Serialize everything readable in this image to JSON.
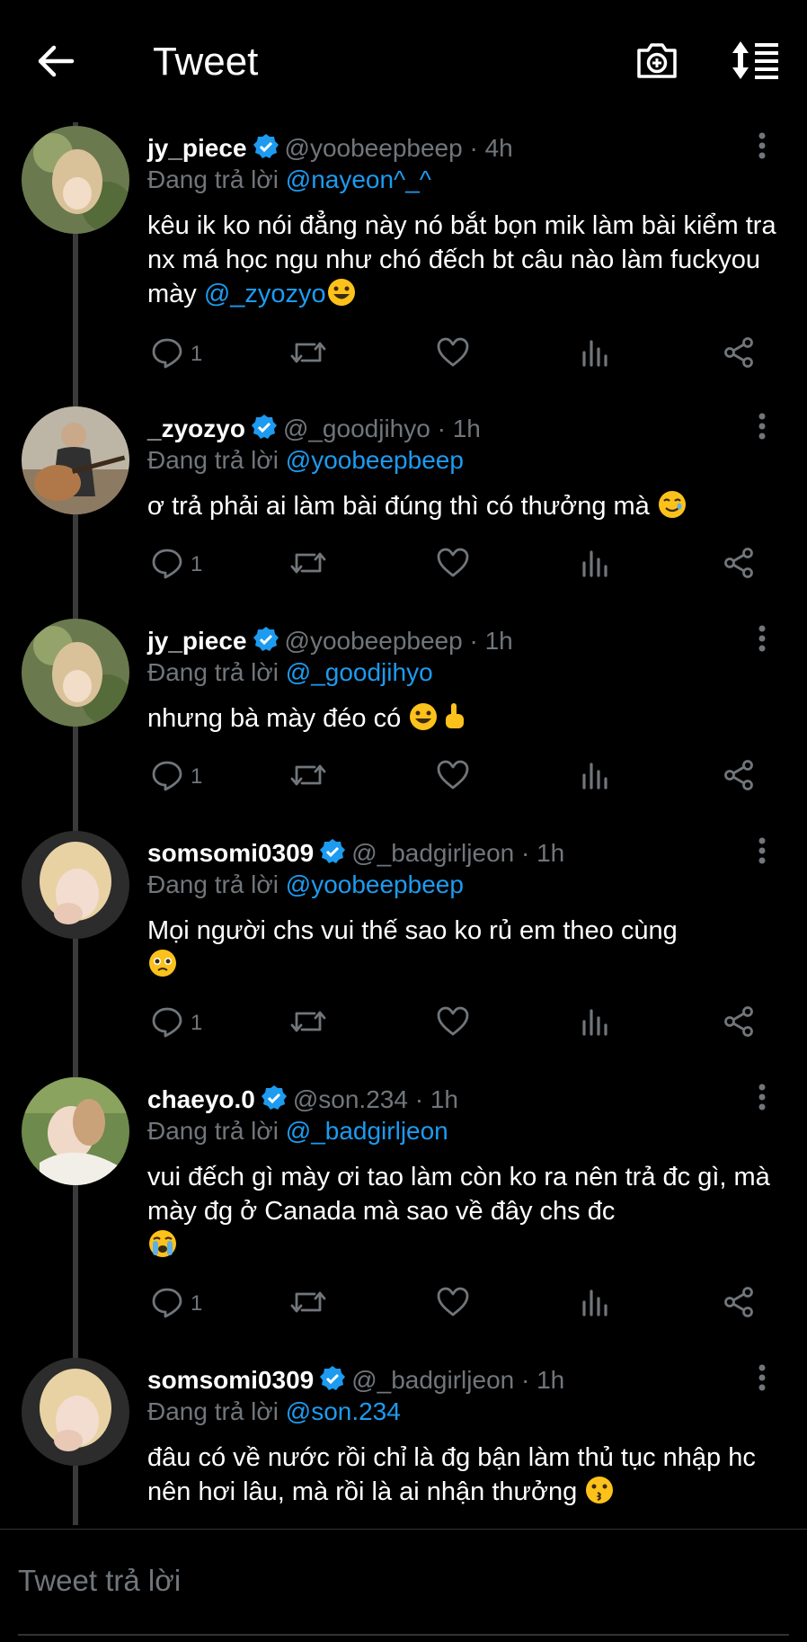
{
  "header": {
    "title": "Tweet"
  },
  "tweets": [
    {
      "name": "jy_piece",
      "handle": "@yoobeepbeep",
      "time": "· 4h",
      "reply_label": "Đang trả lời",
      "reply_to": "@nayeon^_^",
      "body": "kêu ik ko nói đẳng này nó bắt bọn mik làm bài kiểm tra nx má học ngu như chó đếch bt câu nào làm fuckyou mày ",
      "body_mention": "@_zyozyo",
      "emoji": "grinning",
      "replies": "1"
    },
    {
      "name": "_zyozyo",
      "handle": "@_goodjihyo",
      "time": "· 1h",
      "reply_label": "Đang trả lời",
      "reply_to": "@yoobeepbeep",
      "body": "ơ trả phải ai làm bài đúng thì có thưởng mà ",
      "emoji": "smiling-tear",
      "replies": "1"
    },
    {
      "name": "jy_piece",
      "handle": "@yoobeepbeep",
      "time": "· 1h",
      "reply_label": "Đang trả lời",
      "reply_to": "@_goodjihyo",
      "body": "nhưng bà mày đéo có ",
      "emoji": "grinning + middle-finger",
      "replies": "1"
    },
    {
      "name": "somsomi0309",
      "handle": "@_badgirljeon",
      "time": "· 1h",
      "reply_label": "Đang trả lời",
      "reply_to": "@yoobeepbeep",
      "body": "Mọi người chs vui thế sao ko rủ em theo cùng",
      "emoji": "pleading",
      "replies": "1"
    },
    {
      "name": "chaeyo.0",
      "handle": "@son.234",
      "time": "· 1h",
      "reply_label": "Đang trả lời",
      "reply_to": "@_badgirljeon",
      "body": "vui đếch gì mày ơi tao làm còn ko ra nên trả đc gì, mà mày đg ở Canada mà sao về đây chs đc",
      "emoji": "loudly-crying",
      "replies": "1"
    },
    {
      "name": "somsomi0309",
      "handle": "@_badgirljeon",
      "time": "· 1h",
      "reply_label": "Đang trả lời",
      "reply_to": "@son.234",
      "body": "đâu có về nước rồi chỉ là đg bận làm thủ tục nhập hc nên hơi lâu, mà rồi là ai nhận thưởng ",
      "emoji": "kissing"
    }
  ],
  "compose": {
    "placeholder": "Tweet trả lời"
  },
  "colors": {
    "accent": "#1d9bf0",
    "muted": "#71767b",
    "background": "#000000"
  }
}
